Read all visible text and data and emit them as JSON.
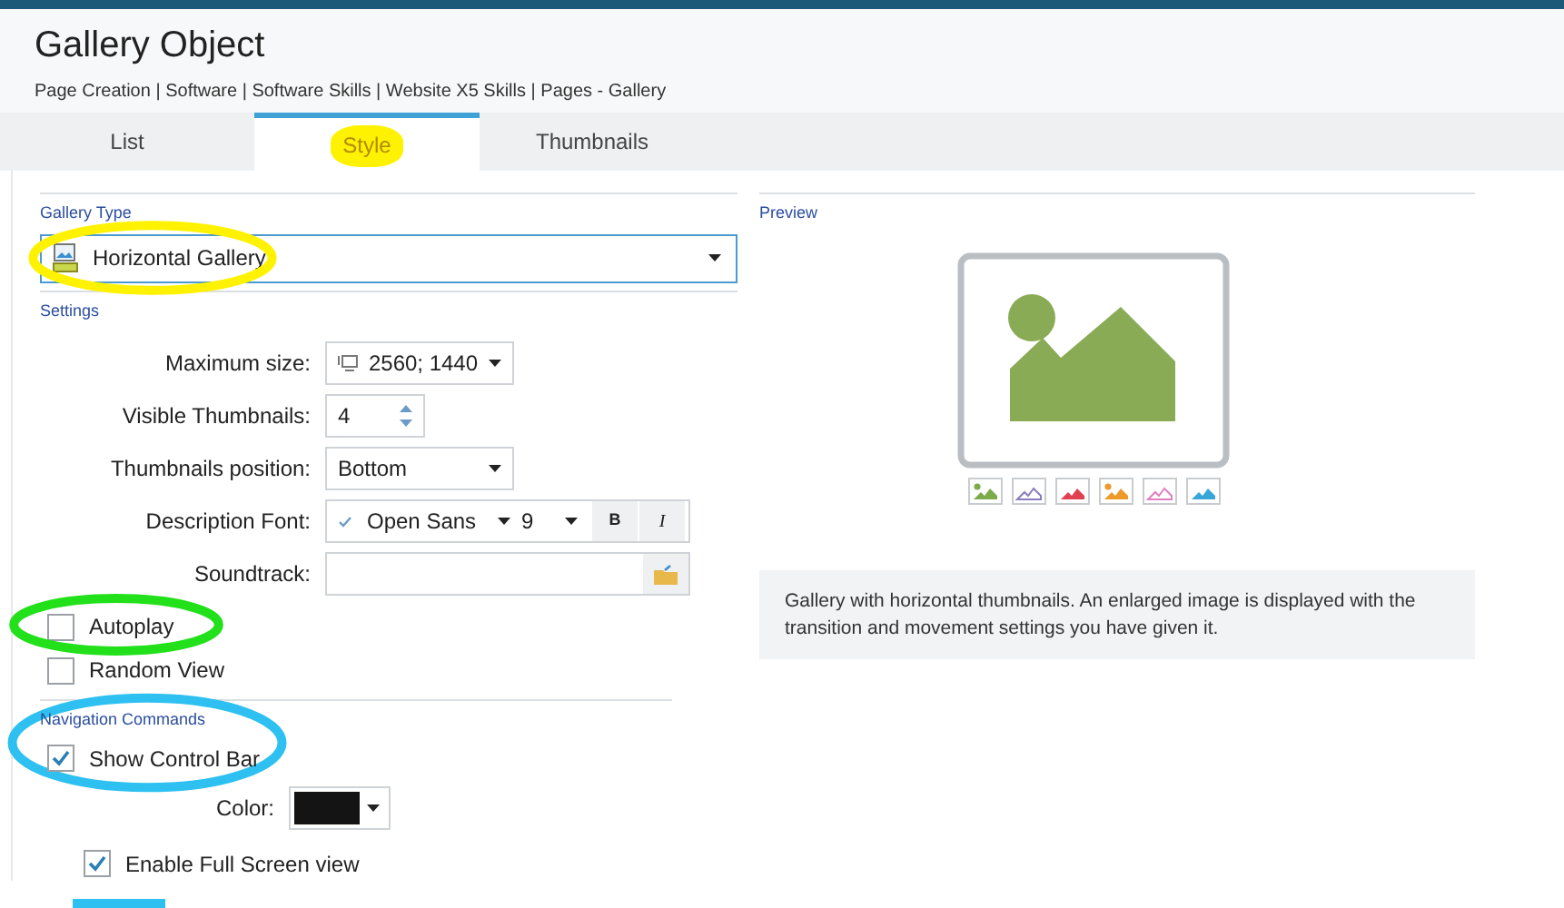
{
  "window": {
    "title": "Gallery Object",
    "breadcrumb": "Page Creation | Software | Software Skills | Website X5 Skills | Pages - Gallery"
  },
  "tabs": [
    {
      "label": "List",
      "selected": false
    },
    {
      "label": "Style",
      "selected": true,
      "highlight": {
        "kind": "fill",
        "color": "#fff200"
      }
    },
    {
      "label": "Thumbnails",
      "selected": false
    }
  ],
  "gallery_type": {
    "label": "Gallery Type",
    "value": "Horizontal Gallery",
    "highlight": {
      "kind": "ring",
      "color": "#fff200"
    }
  },
  "settings": {
    "label": "Settings",
    "fields": [
      {
        "kind": "dropdown",
        "label": "Maximum size:",
        "value": "2560; 1440",
        "icon": true
      },
      {
        "kind": "spinner",
        "label": "Visible Thumbnails:",
        "value": "4"
      },
      {
        "kind": "dropdown",
        "label": "Thumbnails position:",
        "value": "Bottom"
      },
      {
        "kind": "font",
        "label": "Description Font:",
        "value": "Open Sans",
        "size": "9",
        "bold": "B",
        "italic": "I"
      },
      {
        "kind": "file",
        "label": "Soundtrack:"
      }
    ],
    "options": [
      {
        "label": "Autoplay",
        "checked": false,
        "highlight": {
          "kind": "ring",
          "color": "#22e01a"
        }
      },
      {
        "label": "Random View",
        "checked": false
      }
    ]
  },
  "navigation": {
    "label": "Navigation Commands",
    "highlight": {
      "kind": "ring",
      "color": "#2ec0f0"
    },
    "show_control_bar": {
      "label": "Show Control Bar",
      "checked": true
    },
    "color_picker": {
      "label": "Color:",
      "color": "#141414"
    },
    "full_screen": {
      "label": "Enable Full Screen view",
      "checked": true,
      "highlight": {
        "kind": "underline",
        "color": "#2ec0f0"
      }
    }
  },
  "preview": {
    "label": "Preview",
    "thumbnails": [
      {
        "color": "#7cab4a",
        "kind": "filled"
      },
      {
        "color": "#8a7cc0",
        "kind": "outline"
      },
      {
        "color": "#e04050",
        "kind": "filled"
      },
      {
        "color": "#ec9a2a",
        "kind": "filled"
      },
      {
        "color": "#e080c0",
        "kind": "outline"
      },
      {
        "color": "#3aa6d8",
        "kind": "filled"
      }
    ],
    "description": "Gallery with horizontal thumbnails. An enlarged image is displayed with the transition and movement settings you have given it."
  }
}
